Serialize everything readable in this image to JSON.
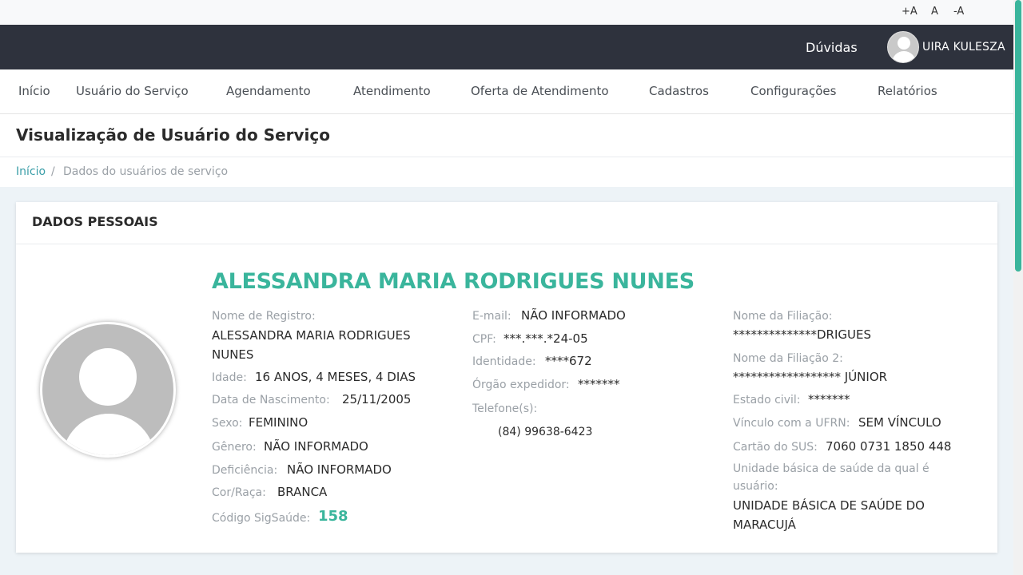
{
  "font_controls": {
    "increase": "+A",
    "normal": "A",
    "decrease": "-A"
  },
  "header": {
    "help": "Dúvidas",
    "user_name": "UIRA KULESZA"
  },
  "nav": {
    "items": [
      "Início",
      "Usuário do Serviço",
      "Agendamento",
      "Atendimento",
      "Oferta de Atendimento",
      "Cadastros",
      "Configurações",
      "Relatórios"
    ]
  },
  "page": {
    "title": "Visualização de Usuário do Serviço"
  },
  "breadcrumb": {
    "home": "Início",
    "separator": "/",
    "current": "Dados do usuários de serviço"
  },
  "card": {
    "title": "DADOS PESSOAIS",
    "name": "ALESSANDRA MARIA RODRIGUES NUNES",
    "col1": {
      "registro_label": "Nome de Registro:",
      "registro_line1": "ALESSANDRA MARIA RODRIGUES",
      "registro_line2": "NUNES",
      "idade_label": "Idade:",
      "idade": "16 ANOS, 4 MESES, 4 DIAS",
      "nascimento_label": "Data de Nascimento:",
      "nascimento": "25/11/2005",
      "sexo_label": "Sexo:",
      "sexo": "FEMININO",
      "genero_label": "Gênero:",
      "genero": "NÃO INFORMADO",
      "deficiencia_label": "Deficiência:",
      "deficiencia": "NÃO INFORMADO",
      "cor_label": "Cor/Raça:",
      "cor": "BRANCA",
      "sigsaude_label": "Código SigSaúde:",
      "sigsaude": "158"
    },
    "col2": {
      "email_label": "E-mail:",
      "email": "NÃO INFORMADO",
      "cpf_label": "CPF:",
      "cpf": "***.***.*24-05",
      "identidade_label": "Identidade:",
      "identidade": "****672",
      "orgao_label": "Órgão expedidor:",
      "orgao": "*******",
      "telefone_label": "Telefone(s):",
      "telefone": "(84) 99638-6423"
    },
    "col3": {
      "filiacao_label": "Nome da Filiação:",
      "filiacao": "**************DRIGUES",
      "filiacao2_label": "Nome da Filiação 2:",
      "filiacao2": "****************** JÚNIOR",
      "estado_civil_label": "Estado civil:",
      "estado_civil": "*******",
      "vinculo_label": "Vínculo com a UFRN:",
      "vinculo": "SEM VÍNCULO",
      "sus_label": "Cartão do SUS:",
      "sus": "7060 0731 1850 448",
      "ubs_label_line1": "Unidade básica de saúde da qual é",
      "ubs_label_line2": "usuário:",
      "ubs_line1": "UNIDADE BÁSICA DE SAÚDE DO",
      "ubs_line2": "MARACUJÁ"
    }
  }
}
